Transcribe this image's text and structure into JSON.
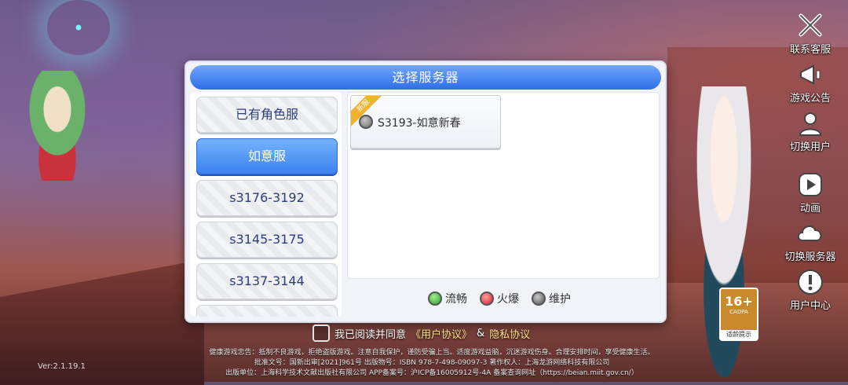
{
  "dialog": {
    "title": "选择服务器",
    "categories": [
      {
        "label": "已有角色服",
        "active": false
      },
      {
        "label": "如意服",
        "active": true
      },
      {
        "label": "s3176-3192",
        "active": false
      },
      {
        "label": "s3145-3175",
        "active": false
      },
      {
        "label": "s3137-3144",
        "active": false
      },
      {
        "label": "",
        "active": false
      }
    ],
    "servers": [
      {
        "tag": "新服",
        "name": "S3193-如意新春",
        "status": "maintenance"
      }
    ],
    "legend": [
      {
        "label": "流畅",
        "status": "smooth"
      },
      {
        "label": "火爆",
        "status": "hot"
      },
      {
        "label": "维护",
        "status": "maintenance"
      }
    ]
  },
  "agreement": {
    "prefix": "我已阅读并同意",
    "user_agreement": "《用户协议》",
    "amp": "&",
    "privacy": "隐私协议"
  },
  "side_menu": [
    {
      "label": "联系客服",
      "icon": "tools-icon"
    },
    {
      "label": "游戏公告",
      "icon": "announcement-icon"
    },
    {
      "label": "切换用户",
      "icon": "switch-user-icon"
    },
    {
      "label": "动画",
      "icon": "play-icon"
    },
    {
      "label": "切换服务器",
      "icon": "cloud-icon"
    },
    {
      "label": "用户中心",
      "icon": "info-icon"
    }
  ],
  "age_badge": {
    "rating": "16+",
    "org": "CADPA",
    "tip": "适龄提示"
  },
  "version": "Ver:2.1.19.1",
  "footer": [
    "健康游戏忠告：抵制不良游戏，拒绝盗版游戏。注意自我保护，谨防受骗上当。适度游戏益脑，沉迷游戏伤身。合理安排时间，享受健康生活。",
    "批准文号：国新出审[2021]961号   出版物号：ISBN 978-7-498-09097-3 著作权人：上海龙游网络科技有限公司",
    "出版单位：上海科学技术文献出版社有限公司 APP备案号：沪ICP备16005912号-4A 备案查询网址（https://beian.miit.gov.cn/）"
  ],
  "colors": {
    "accent": "#3b82ee",
    "title_bar": "#2d6ee6",
    "new_tag": "#f2b12e"
  }
}
